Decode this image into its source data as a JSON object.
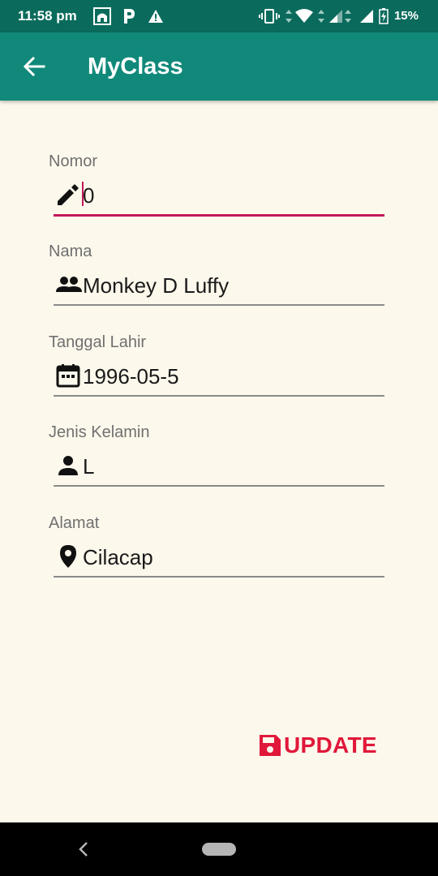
{
  "status_bar": {
    "time": "11:58 pm",
    "battery_text": "15%"
  },
  "app_bar": {
    "title": "MyClass",
    "back_icon": "arrow-back-icon"
  },
  "form": {
    "fields": [
      {
        "label": "Nomor",
        "value": "0",
        "icon": "pencil-icon"
      },
      {
        "label": "Nama",
        "value": "Monkey D Luffy",
        "icon": "group-icon"
      },
      {
        "label": "Tanggal Lahir",
        "value": "1996-05-5",
        "icon": "calendar-icon"
      },
      {
        "label": "Jenis Kelamin",
        "value": "L",
        "icon": "person-icon"
      },
      {
        "label": "Alamat",
        "value": "Cilacap",
        "icon": "location-pin-icon"
      }
    ]
  },
  "update_button": {
    "label": "UPDATE",
    "icon": "save-icon",
    "color": "#e0183a"
  },
  "colors": {
    "status_bar": "#0a6b5c",
    "app_bar": "#11897a",
    "background": "#fdf8ec",
    "focus_accent": "#c2185b"
  }
}
